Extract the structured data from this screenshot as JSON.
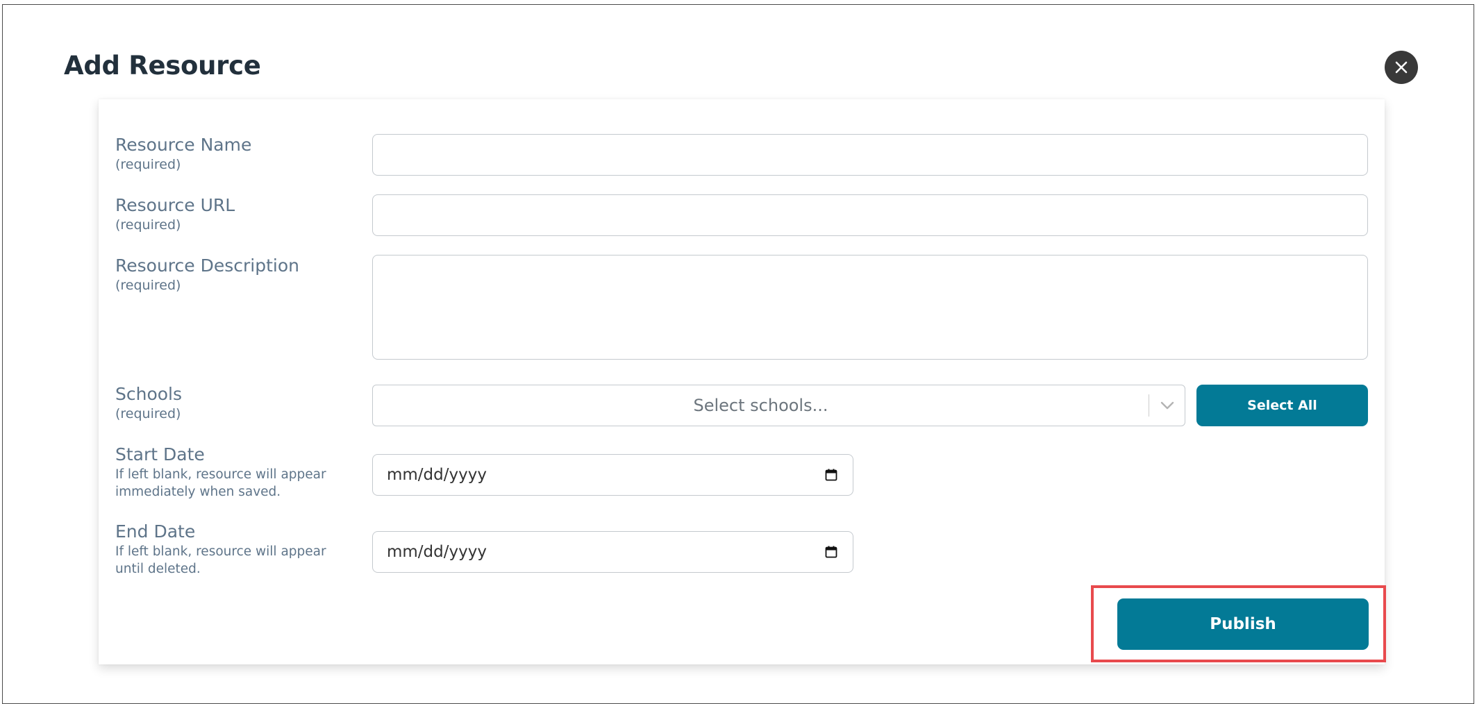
{
  "modal": {
    "title": "Add Resource",
    "close_icon": "close-icon"
  },
  "form": {
    "resource_name": {
      "label": "Resource Name",
      "note": "(required)",
      "value": "",
      "placeholder": ""
    },
    "resource_url": {
      "label": "Resource URL",
      "note": "(required)",
      "value": "",
      "placeholder": ""
    },
    "resource_description": {
      "label": "Resource Description",
      "note": "(required)",
      "value": "",
      "placeholder": ""
    },
    "schools": {
      "label": "Schools",
      "note": "(required)",
      "placeholder": "Select schools...",
      "select_all_label": "Select All",
      "dropdown_icon": "chevron-down-icon"
    },
    "start_date": {
      "label": "Start Date",
      "note_line1": "If left blank, resource will appear",
      "note_line2": "immediately when saved.",
      "placeholder": "mm/dd/yyyy",
      "icon": "calendar-icon"
    },
    "end_date": {
      "label": "End Date",
      "note_line1": "If left blank, resource will appear",
      "note_line2": "until deleted.",
      "placeholder": "mm/dd/yyyy",
      "icon": "calendar-icon"
    },
    "publish_label": "Publish"
  },
  "colors": {
    "primary": "#037a96",
    "highlight": "#e84a4d",
    "label_text": "#5e7489",
    "close_button": "#393939",
    "title_text": "#22303c"
  }
}
